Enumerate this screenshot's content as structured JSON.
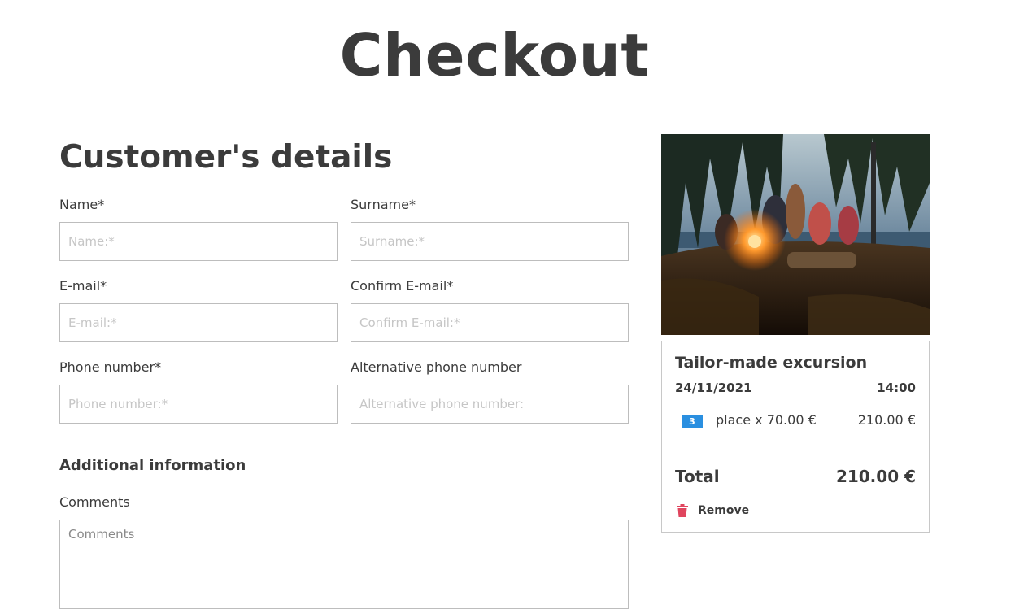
{
  "page": {
    "title": "Checkout"
  },
  "customer": {
    "section_title": "Customer's details",
    "name": {
      "label": "Name*",
      "placeholder": "Name:*"
    },
    "surname": {
      "label": "Surname*",
      "placeholder": "Surname:*"
    },
    "email": {
      "label": "E-mail*",
      "placeholder": "E-mail:*"
    },
    "confirm_email": {
      "label": "Confirm E-mail*",
      "placeholder": "Confirm E-mail:*"
    },
    "phone": {
      "label": "Phone number*",
      "placeholder": "Phone number:*"
    },
    "alt_phone": {
      "label": "Alternative phone number",
      "placeholder": "Alternative phone number:"
    }
  },
  "additional": {
    "title": "Additional information",
    "comments_label": "Comments",
    "comments_placeholder": "Comments"
  },
  "cart": {
    "item_title": "Tailor-made excursion",
    "date": "24/11/2021",
    "time": "14:00",
    "quantity": "3",
    "line_description": "place x 70.00 €",
    "line_price": "210.00 €",
    "total_label": "Total",
    "total_value": "210.00 €",
    "remove_label": "Remove",
    "remove_icon": "trash-icon",
    "image_subject": "campfire-photo"
  },
  "colors": {
    "text": "#3b3b3b",
    "badge": "#2a8fe0",
    "remove_icon": "#e0455e",
    "border": "#bdbdbd"
  }
}
